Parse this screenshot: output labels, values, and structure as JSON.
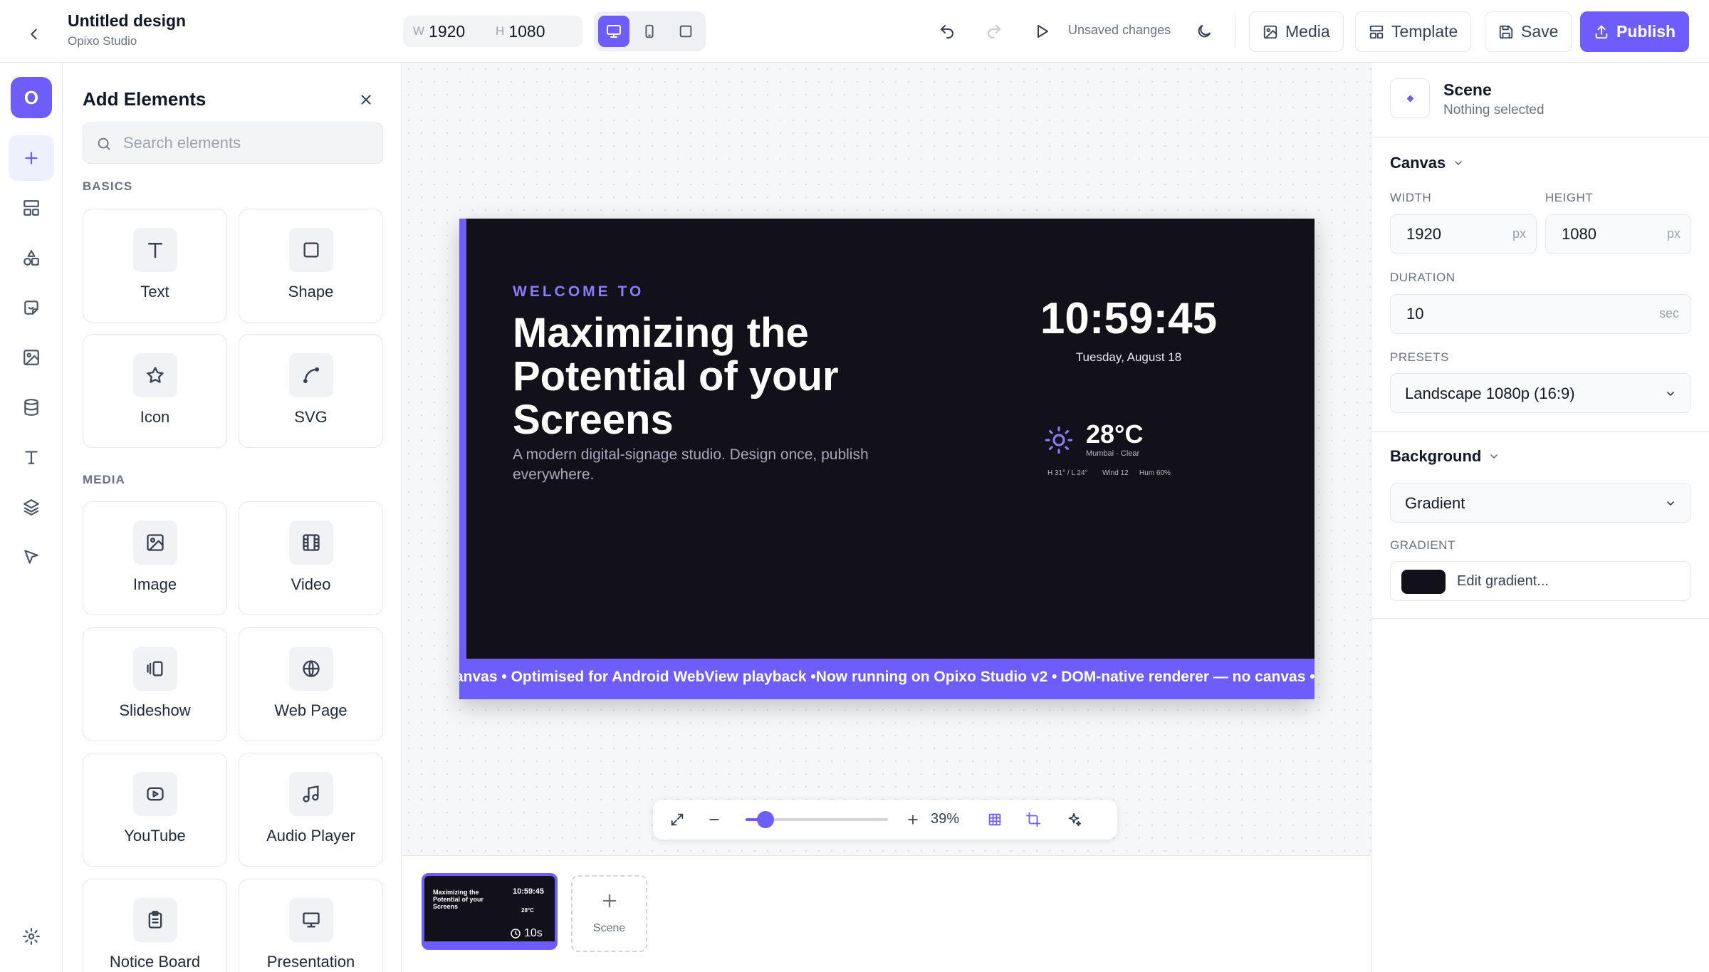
{
  "header": {
    "title": "Untitled design",
    "subtitle": "Opixo Studio",
    "width_label": "W",
    "width_value": "1920",
    "height_label": "H",
    "height_value": "1080",
    "status": "Unsaved changes",
    "buttons": {
      "media": "Media",
      "template": "Template",
      "save": "Save",
      "publish": "Publish"
    }
  },
  "rail": {
    "logo": "O"
  },
  "elements_panel": {
    "title": "Add Elements",
    "search_placeholder": "Search elements",
    "sections": {
      "basics": {
        "label": "BASICS",
        "items": [
          "Text",
          "Shape",
          "Icon",
          "SVG"
        ]
      },
      "media": {
        "label": "MEDIA",
        "items": [
          "Image",
          "Video",
          "Slideshow",
          "Web Page",
          "YouTube",
          "Audio Player",
          "Notice Board",
          "Presentation"
        ]
      }
    }
  },
  "slide": {
    "eyebrow": "WELCOME TO",
    "headline": "Maximizing the Potential of your Screens",
    "description": "A modern digital-signage studio. Design once, publish everywhere.",
    "clock": "10:59:45",
    "date": "Tuesday, August 18",
    "weather": {
      "temperature": "28°C",
      "location": "Mumbai · Clear",
      "high_low": "H 31° / L 24°",
      "wind": "Wind 12",
      "humidity": "Hum 60%"
    },
    "ticker": "anvas • Optimised for Android WebView playback •Now running on Opixo Studio v2 • DOM-native renderer — no canvas • Op"
  },
  "zoom": {
    "value": 39,
    "label": "39%",
    "slider_fraction": 0.14
  },
  "scenes": {
    "thumb_headline": "Maximizing the Potential of your Screens",
    "thumb_clock": "10:59:45",
    "thumb_temp": "28°C",
    "duration": "10s",
    "add_label": "Scene"
  },
  "properties": {
    "title": "Scene",
    "subtitle": "Nothing selected",
    "canvas": {
      "heading": "Canvas",
      "width_label": "WIDTH",
      "width_value": "1920",
      "height_label": "HEIGHT",
      "height_value": "1080",
      "px_unit": "px",
      "duration_label": "DURATION",
      "duration_value": "10",
      "duration_unit": "sec",
      "presets_label": "PRESETS",
      "preset_value": "Landscape 1080p (16:9)"
    },
    "background": {
      "heading": "Background",
      "type_value": "Gradient",
      "gradient_label": "GRADIENT",
      "gradient_button": "Edit gradient..."
    }
  },
  "colors": {
    "accent": "#6d5dfc",
    "slide_bg": "#121019",
    "accent_text": "#8b7cff"
  }
}
